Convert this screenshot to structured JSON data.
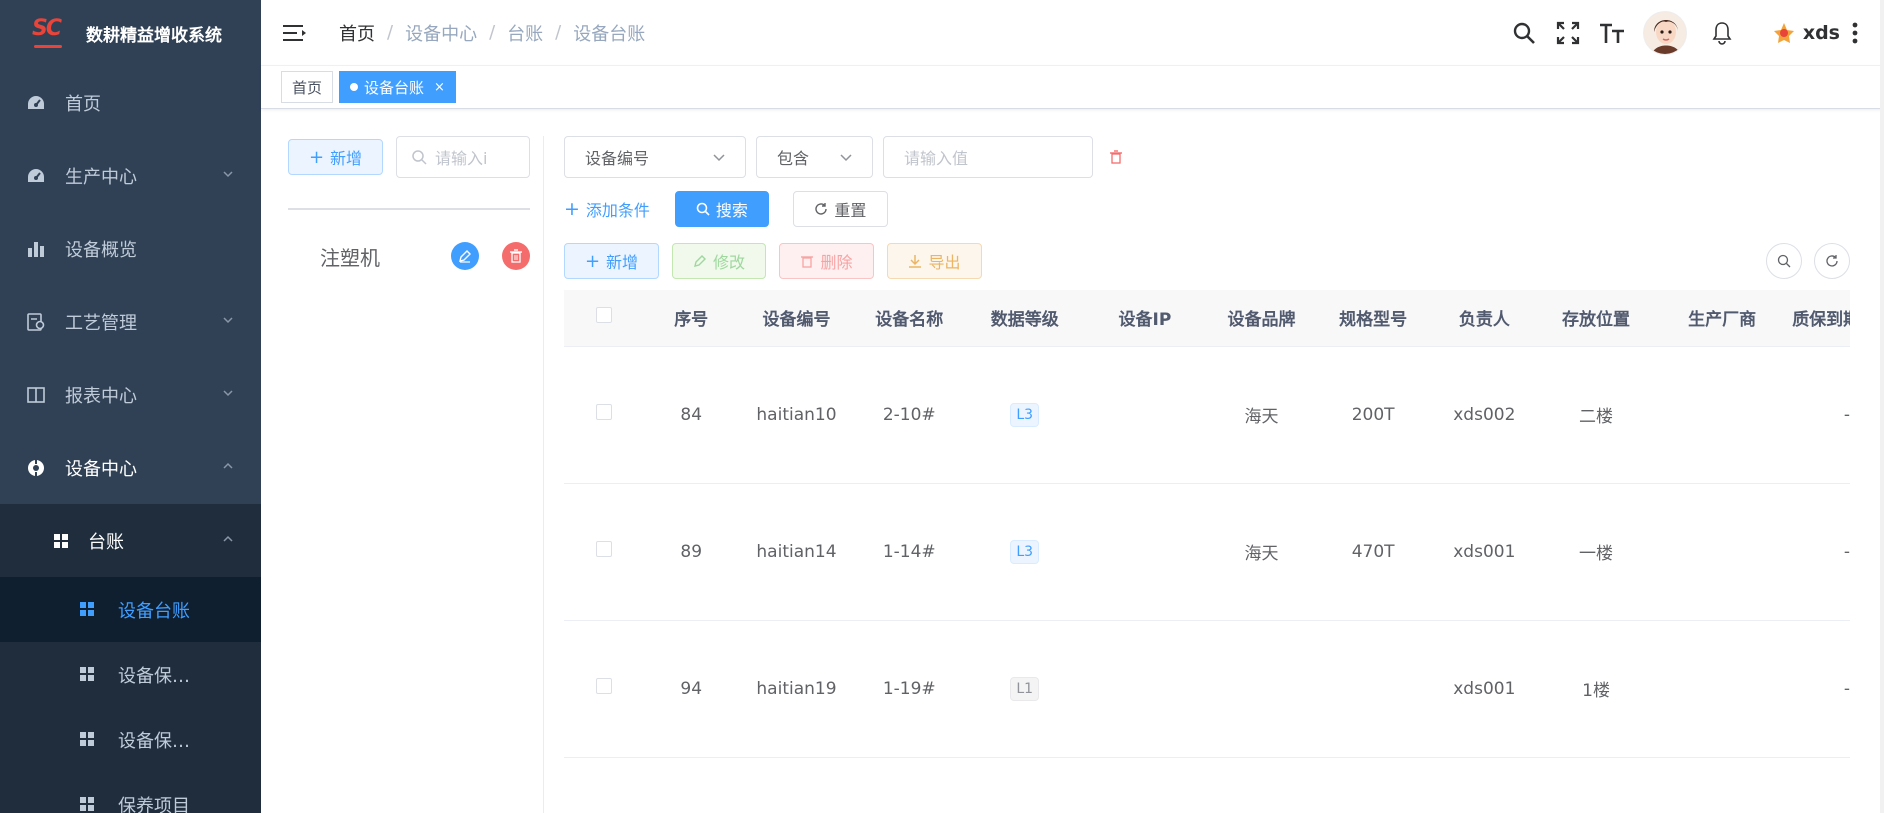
{
  "app": {
    "logo_text": "SC",
    "title": "数耕精益增收系统"
  },
  "sidebar": {
    "items": [
      {
        "label": "首页",
        "icon": "dashboard-icon"
      },
      {
        "label": "生产中心",
        "icon": "dashboard-icon"
      },
      {
        "label": "设备概览",
        "icon": "bar-chart-icon"
      },
      {
        "label": "工艺管理",
        "icon": "process-icon"
      },
      {
        "label": "报表中心",
        "icon": "book-icon"
      },
      {
        "label": "设备中心",
        "icon": "equipment-icon"
      }
    ],
    "sub": {
      "label": "台账",
      "items": [
        {
          "label": "设备台账",
          "active": true
        },
        {
          "label": "设备保…"
        },
        {
          "label": "设备保…"
        },
        {
          "label": "保养项目"
        }
      ]
    }
  },
  "header": {
    "breadcrumb": [
      "首页",
      "设备中心",
      "台账",
      "设备台账"
    ],
    "username": "xds"
  },
  "tags": [
    {
      "label": "首页",
      "active": false
    },
    {
      "label": "设备台账",
      "active": true,
      "close": "×"
    }
  ],
  "left_panel": {
    "add_label": "新增",
    "search_placeholder": "请输入i",
    "tree": [
      {
        "label": "注塑机"
      }
    ]
  },
  "query": {
    "field_select": "设备编号",
    "op_select": "包含",
    "value_placeholder": "请输入值",
    "add_condition": "添加条件",
    "search_label": "搜索",
    "reset_label": "重置"
  },
  "toolbar": {
    "add": "新增",
    "edit": "修改",
    "delete": "删除",
    "export": "导出"
  },
  "table": {
    "columns": [
      "序号",
      "设备编号",
      "设备名称",
      "数据等级",
      "设备IP",
      "设备品牌",
      "规格型号",
      "负责人",
      "存放位置",
      "生产厂商",
      "质保到期"
    ],
    "rows": [
      {
        "seq": "84",
        "code": "haitian10",
        "name": "2-10#",
        "level": "L3",
        "ip": "",
        "brand": "海天",
        "model": "200T",
        "owner": "xds002",
        "location": "二楼",
        "maker": "",
        "warranty": "-"
      },
      {
        "seq": "89",
        "code": "haitian14",
        "name": "1-14#",
        "level": "L3",
        "ip": "",
        "brand": "海天",
        "model": "470T",
        "owner": "xds001",
        "location": "一楼",
        "maker": "",
        "warranty": "-"
      },
      {
        "seq": "94",
        "code": "haitian19",
        "name": "1-19#",
        "level": "L1",
        "ip": "",
        "brand": "",
        "model": "",
        "owner": "xds001",
        "location": "1楼",
        "maker": "",
        "warranty": "-"
      }
    ]
  },
  "colors": {
    "sidebar_bg": "#304156",
    "sidebar_active_bg": "#0f1f30",
    "primary": "#409eff",
    "danger": "#f56c6c"
  }
}
